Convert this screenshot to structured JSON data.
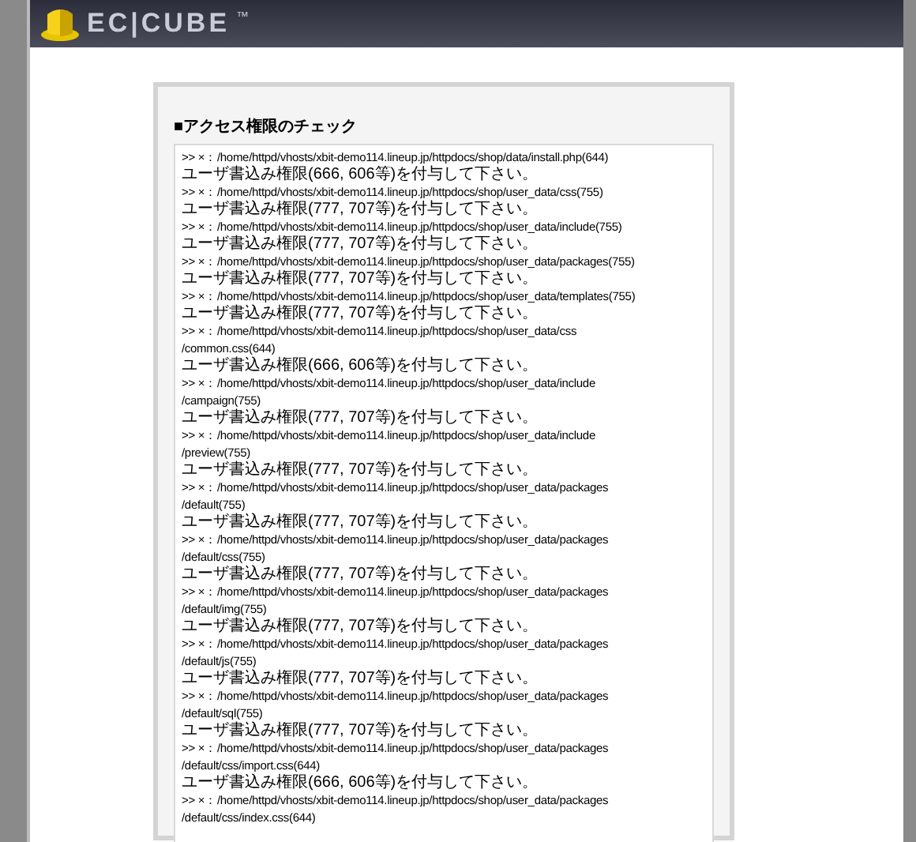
{
  "header": {
    "logo": "EC|CUBE",
    "trademark": "™"
  },
  "section": {
    "title": "■アクセス権限のチェック",
    "lines": [
      {
        "kind": "path",
        "text": ">> ×：/home/httpd/vhosts/xbit-demo114.lineup.jp/httpdocs/shop/data/install.php(644)"
      },
      {
        "kind": "message",
        "text": "ユーザ書込み権限(666, 606等)を付与して下さい。"
      },
      {
        "kind": "path",
        "text": ">> ×：/home/httpd/vhosts/xbit-demo114.lineup.jp/httpdocs/shop/user_data/css(755)"
      },
      {
        "kind": "message",
        "text": "ユーザ書込み権限(777, 707等)を付与して下さい。"
      },
      {
        "kind": "path",
        "text": ">> ×：/home/httpd/vhosts/xbit-demo114.lineup.jp/httpdocs/shop/user_data/include(755)"
      },
      {
        "kind": "message",
        "text": "ユーザ書込み権限(777, 707等)を付与して下さい。"
      },
      {
        "kind": "path",
        "text": ">> ×：/home/httpd/vhosts/xbit-demo114.lineup.jp/httpdocs/shop/user_data/packages(755)"
      },
      {
        "kind": "message",
        "text": "ユーザ書込み権限(777, 707等)を付与して下さい。"
      },
      {
        "kind": "path",
        "text": ">> ×：/home/httpd/vhosts/xbit-demo114.lineup.jp/httpdocs/shop/user_data/templates(755)"
      },
      {
        "kind": "message",
        "text": "ユーザ書込み権限(777, 707等)を付与して下さい。"
      },
      {
        "kind": "path",
        "text": ">> ×：/home/httpd/vhosts/xbit-demo114.lineup.jp/httpdocs/shop/user_data/css"
      },
      {
        "kind": "path",
        "text": "/common.css(644)"
      },
      {
        "kind": "message",
        "text": "ユーザ書込み権限(666, 606等)を付与して下さい。"
      },
      {
        "kind": "path",
        "text": ">> ×：/home/httpd/vhosts/xbit-demo114.lineup.jp/httpdocs/shop/user_data/include"
      },
      {
        "kind": "path",
        "text": "/campaign(755)"
      },
      {
        "kind": "message",
        "text": "ユーザ書込み権限(777, 707等)を付与して下さい。"
      },
      {
        "kind": "path",
        "text": ">> ×：/home/httpd/vhosts/xbit-demo114.lineup.jp/httpdocs/shop/user_data/include"
      },
      {
        "kind": "path",
        "text": "/preview(755)"
      },
      {
        "kind": "message",
        "text": "ユーザ書込み権限(777, 707等)を付与して下さい。"
      },
      {
        "kind": "path",
        "text": ">> ×：/home/httpd/vhosts/xbit-demo114.lineup.jp/httpdocs/shop/user_data/packages"
      },
      {
        "kind": "path",
        "text": "/default(755)"
      },
      {
        "kind": "message",
        "text": "ユーザ書込み権限(777, 707等)を付与して下さい。"
      },
      {
        "kind": "path",
        "text": ">> ×：/home/httpd/vhosts/xbit-demo114.lineup.jp/httpdocs/shop/user_data/packages"
      },
      {
        "kind": "path",
        "text": "/default/css(755)"
      },
      {
        "kind": "message",
        "text": "ユーザ書込み権限(777, 707等)を付与して下さい。"
      },
      {
        "kind": "path",
        "text": ">> ×：/home/httpd/vhosts/xbit-demo114.lineup.jp/httpdocs/shop/user_data/packages"
      },
      {
        "kind": "path",
        "text": "/default/img(755)"
      },
      {
        "kind": "message",
        "text": "ユーザ書込み権限(777, 707等)を付与して下さい。"
      },
      {
        "kind": "path",
        "text": ">> ×：/home/httpd/vhosts/xbit-demo114.lineup.jp/httpdocs/shop/user_data/packages"
      },
      {
        "kind": "path",
        "text": "/default/js(755)"
      },
      {
        "kind": "message",
        "text": "ユーザ書込み権限(777, 707等)を付与して下さい。"
      },
      {
        "kind": "path",
        "text": ">> ×：/home/httpd/vhosts/xbit-demo114.lineup.jp/httpdocs/shop/user_data/packages"
      },
      {
        "kind": "path",
        "text": "/default/sql(755)"
      },
      {
        "kind": "message",
        "text": "ユーザ書込み権限(777, 707等)を付与して下さい。"
      },
      {
        "kind": "path",
        "text": ">> ×：/home/httpd/vhosts/xbit-demo114.lineup.jp/httpdocs/shop/user_data/packages"
      },
      {
        "kind": "path",
        "text": "/default/css/import.css(644)"
      },
      {
        "kind": "message",
        "text": "ユーザ書込み権限(666, 606等)を付与して下さい。"
      },
      {
        "kind": "path",
        "text": ">> ×：/home/httpd/vhosts/xbit-demo114.lineup.jp/httpdocs/shop/user_data/packages"
      },
      {
        "kind": "path",
        "text": "/default/css/index.css(644)"
      }
    ]
  }
}
